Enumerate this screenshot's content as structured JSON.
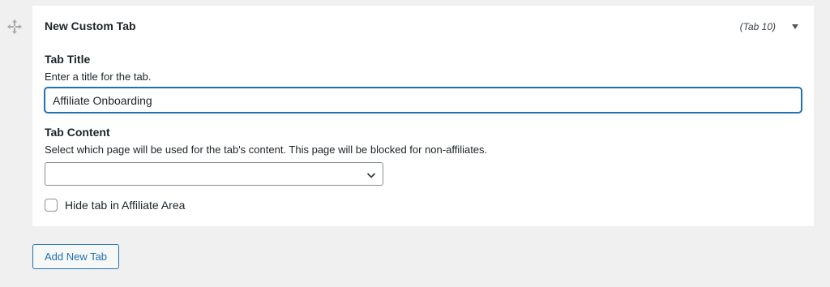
{
  "panel": {
    "title": "New Custom Tab",
    "tab_number": "(Tab 10)"
  },
  "icons": {
    "drag": "move-arrows-icon",
    "toggle": "triangle-down-icon",
    "select_arrow": "chevron-down-icon"
  },
  "tab_title": {
    "label": "Tab Title",
    "description": "Enter a title for the tab.",
    "value": "Affiliate Onboarding"
  },
  "tab_content": {
    "label": "Tab Content",
    "description": "Select which page will be used for the tab's content. This page will be blocked for non-affiliates.",
    "selected": ""
  },
  "hide_tab": {
    "label": "Hide tab in Affiliate Area",
    "checked": false
  },
  "actions": {
    "add_new_tab": "Add New Tab"
  },
  "colors": {
    "accent": "#2271b1",
    "background": "#f0f0f1",
    "panel": "#ffffff"
  }
}
